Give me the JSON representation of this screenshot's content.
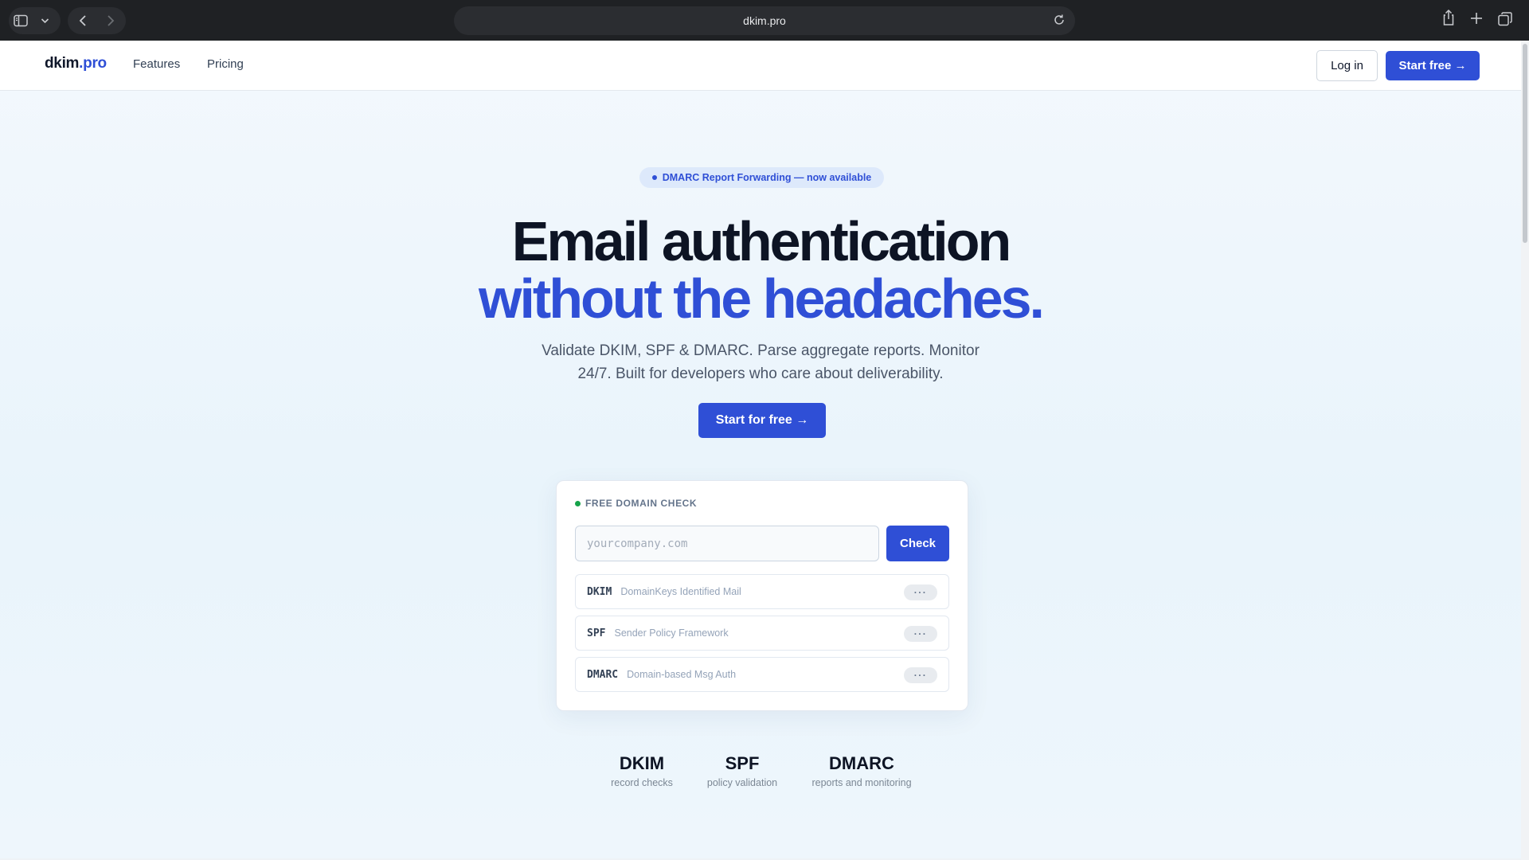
{
  "browser": {
    "url": "dkim.pro"
  },
  "navbar": {
    "logo_main": "dkim",
    "logo_accent": ".pro",
    "links": [
      "Features",
      "Pricing"
    ],
    "login_label": "Log in",
    "start_label": "Start free →"
  },
  "hero": {
    "badge": "DMARC Report Forwarding — now available",
    "headline_line1": "Email authentication",
    "headline_line2": "without the headaches.",
    "subheadline": "Validate DKIM, SPF & DMARC. Parse aggregate reports. Monitor 24/7. Built for developers who care about deliverability.",
    "cta_label": "Start for free →"
  },
  "domain_check": {
    "label": "FREE DOMAIN CHECK",
    "input_placeholder": "yourcompany.com",
    "input_value": "",
    "button_label": "Check",
    "rows": [
      {
        "code": "DKIM",
        "description": "DomainKeys Identified Mail",
        "status": "···"
      },
      {
        "code": "SPF",
        "description": "Sender Policy Framework",
        "status": "···"
      },
      {
        "code": "DMARC",
        "description": "Domain-based Msg Auth",
        "status": "···"
      }
    ]
  },
  "stats": [
    {
      "title": "DKIM",
      "caption": "record checks"
    },
    {
      "title": "SPF",
      "caption": "policy validation"
    },
    {
      "title": "DMARC",
      "caption": "reports and monitoring"
    }
  ],
  "colors": {
    "accent": "#2f4fd6",
    "status_dot": "#16a34a",
    "heading": "#0d1424"
  },
  "icons": [
    "sidebar-icon",
    "chevron-down-icon",
    "back-arrow-icon",
    "forward-arrow-icon",
    "reload-icon",
    "share-icon",
    "new-tab-icon",
    "tabs-overview-icon"
  ]
}
